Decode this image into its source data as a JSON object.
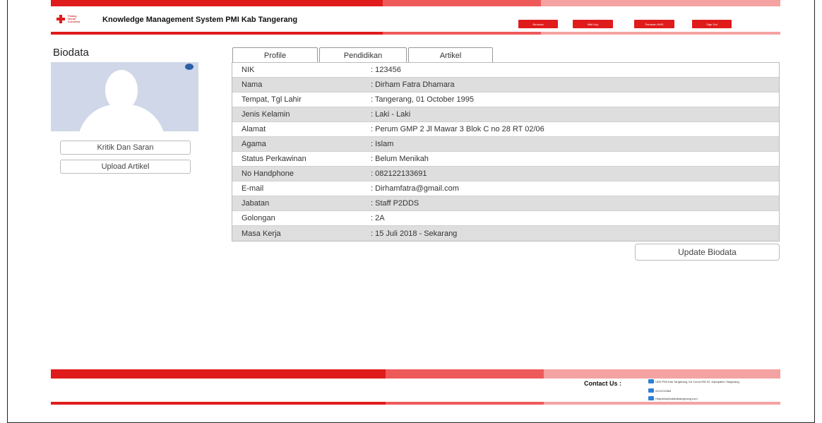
{
  "header": {
    "logo_text": "Palang Merah Indonesia",
    "title": "Knowledge Management System PMI Kab Tangerang",
    "nav": [
      "Beranda",
      "Wiki Kuy",
      "Panduan KMS",
      "Sign Out"
    ]
  },
  "sidebar": {
    "title": "Biodata",
    "buttons": [
      "Kritik Dan Saran",
      "Upload Artikel"
    ]
  },
  "tabs": [
    "Profile",
    "Pendidikan",
    "Artikel"
  ],
  "profile": [
    {
      "label": "NIK",
      "value": ": 123456"
    },
    {
      "label": "Nama",
      "value": ": Dirham Fatra Dhamara"
    },
    {
      "label": "Tempat, Tgl Lahir",
      "value": ": Tangerang, 01 October 1995"
    },
    {
      "label": "Jenis Kelamin",
      "value": ": Laki - Laki"
    },
    {
      "label": "Alamat",
      "value": ": Perum GMP 2 Jl Mawar 3 Blok C no 28 RT 02/06"
    },
    {
      "label": "Agama",
      "value": ": Islam"
    },
    {
      "label": "Status Perkawinan",
      "value": ": Belum Menikah"
    },
    {
      "label": "No Handphone",
      "value": ": 082122133691"
    },
    {
      "label": "E-mail",
      "value": ": Dirhamfatra@gmail.com"
    },
    {
      "label": "Jabatan",
      "value": ": Staff P2DDS"
    },
    {
      "label": "Golongan",
      "value": ": 2A"
    },
    {
      "label": "Masa Kerja",
      "value": ": 15 Juli 2018 - Sekarang"
    }
  ],
  "update_button": "Update Biodata",
  "footer": {
    "contact_label": "Contact Us :",
    "address": "UDD PMI Kab Tangerang, Kb Cunut RW 02, Kabupaten Tangerang",
    "phone": "0212213364",
    "email": "Helpdesk@uddtabtangerang.com"
  },
  "colors": {
    "primary": "#e01b1b",
    "mid": "#ee5a5a",
    "light": "#f5a2a2",
    "row_alt": "#dedede"
  },
  "icons": {
    "logo": "red-cross-icon",
    "settings": "gear-icon",
    "address": "location-icon",
    "phone": "phone-icon",
    "email": "email-icon"
  }
}
